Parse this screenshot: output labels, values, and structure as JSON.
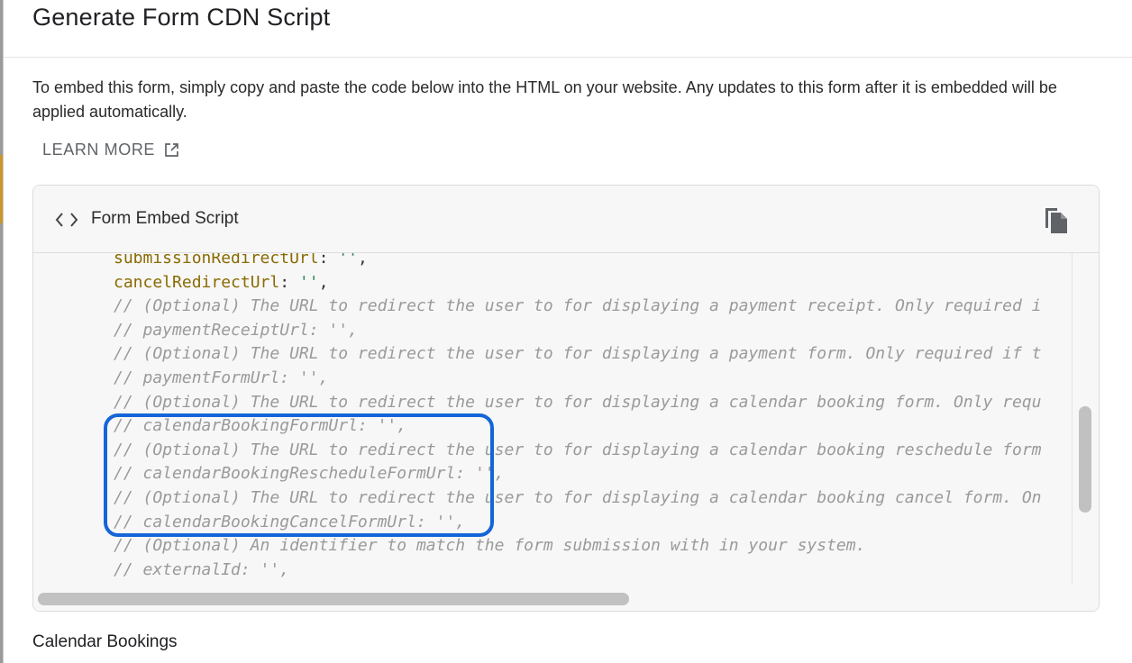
{
  "modal": {
    "title": "Generate Form CDN Script",
    "description": "To embed this form, simply copy and paste the code below into the HTML on your website. Any updates to this form after it is embedded will be applied automatically.",
    "learn_more_label": "LEARN MORE",
    "learn_more_icon": "external-link-icon"
  },
  "script_card": {
    "title": "Form Embed Script",
    "header_icon": "code-brackets-icon",
    "copy_icon": "copy-icon",
    "code_lines": [
      {
        "prop": "submissionRedirectUrl",
        "sep": ": ",
        "str": "''",
        "end": ","
      },
      {
        "prop": "cancelRedirectUrl",
        "sep": ": ",
        "str": "''",
        "end": ","
      },
      {
        "comment": "// (Optional) The URL to redirect the user to for displaying a payment receipt. Only required i"
      },
      {
        "comment": "// paymentReceiptUrl: '',"
      },
      {
        "comment": "// (Optional) The URL to redirect the user to for displaying a payment form. Only required if t"
      },
      {
        "comment": "// paymentFormUrl: '',"
      },
      {
        "comment": "// (Optional) The URL to redirect the user to for displaying a calendar booking form. Only requ"
      },
      {
        "comment": "// calendarBookingFormUrl: '',"
      },
      {
        "comment": "// (Optional) The URL to redirect the user to for displaying a calendar booking reschedule form"
      },
      {
        "comment": "// calendarBookingRescheduleFormUrl: '',"
      },
      {
        "comment": "// (Optional) The URL to redirect the user to for displaying a calendar booking cancel form. On"
      },
      {
        "comment": "// calendarBookingCancelFormUrl: '',"
      },
      {
        "comment": "// (Optional) An identifier to match the form submission with in your system."
      },
      {
        "comment": "// externalId: '',"
      }
    ]
  },
  "section": {
    "calendar_bookings_title": "Calendar Bookings"
  },
  "colors": {
    "highlight": "#1565d8",
    "property": "#8a6a00",
    "string": "#2e8b57",
    "comment": "#9a9a9a"
  }
}
